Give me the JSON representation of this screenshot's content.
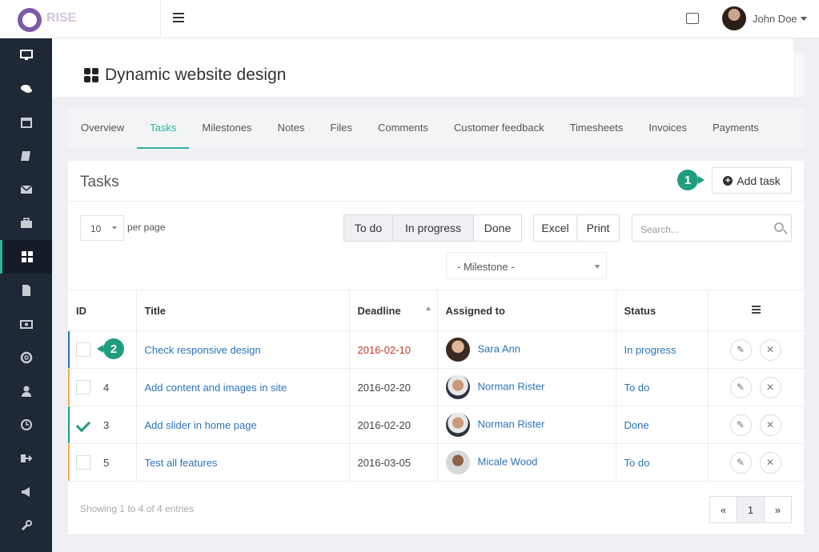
{
  "topbar": {
    "logo_text": "RISE",
    "user_name": "John Doe"
  },
  "sidebar": {
    "icons": [
      "desktop-icon",
      "comments-icon",
      "calendar-icon",
      "book-icon",
      "envelope-icon",
      "briefcase-icon",
      "th-large-icon",
      "file-icon",
      "money-icon",
      "life-ring-icon",
      "user-icon",
      "clock-icon",
      "sign-out-icon",
      "bullhorn-icon",
      "wrench-icon"
    ],
    "active_index": 6
  },
  "page": {
    "title": "Dynamic website design"
  },
  "tabs": [
    "Overview",
    "Tasks",
    "Milestones",
    "Notes",
    "Files",
    "Comments",
    "Customer feedback",
    "Timesheets",
    "Invoices",
    "Payments"
  ],
  "active_tab": "Tasks",
  "panel": {
    "title": "Tasks",
    "add_task_label": "Add task",
    "step1": "1",
    "step2": "2",
    "per_page_value": "10",
    "per_page_label": "per page",
    "status_filters": [
      "To do",
      "In progress",
      "Done"
    ],
    "export_buttons": [
      "Excel",
      "Print"
    ],
    "search_placeholder": "Search...",
    "milestone_placeholder": "- Milestone -",
    "showing": "Showing 1 to 4 of 4 entries",
    "pager": {
      "prev": "«",
      "page": "1",
      "next": "»"
    }
  },
  "table": {
    "columns": [
      "ID",
      "Title",
      "Deadline",
      "Assigned to",
      "Status"
    ],
    "rows": [
      {
        "id": "",
        "title": "Check responsive design",
        "deadline": "2016-02-10",
        "assignee": "Sara Ann",
        "status": "In progress",
        "bar_color": "#2b74b8",
        "checked": false
      },
      {
        "id": "4",
        "title": "Add content and images in site",
        "deadline": "2016-02-20",
        "assignee": "Norman Rister",
        "status": "To do",
        "bar_color": "#f0ad4e",
        "checked": false
      },
      {
        "id": "3",
        "title": "Add slider in home page",
        "deadline": "2016-02-20",
        "assignee": "Norman Rister",
        "status": "Done",
        "bar_color": "#1f9d7e",
        "checked": true
      },
      {
        "id": "5",
        "title": "Test all features",
        "deadline": "2016-03-05",
        "assignee": "Micale Wood",
        "status": "To do",
        "bar_color": "#f0ad4e",
        "checked": false
      }
    ]
  },
  "colors": {
    "accent": "#2eb398",
    "sidebar": "#1f2935",
    "link": "#2b74b8",
    "late": "#c0392b"
  }
}
